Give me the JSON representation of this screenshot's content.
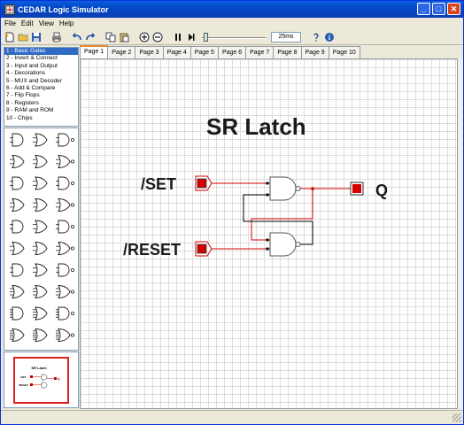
{
  "window": {
    "title": "CEDAR Logic Simulator"
  },
  "menu": [
    "File",
    "Edit",
    "View",
    "Help"
  ],
  "toolbar": {
    "speed": "25ms"
  },
  "tabs": [
    "Page 1",
    "Page 2",
    "Page 3",
    "Page 4",
    "Page 5",
    "Page 6",
    "Page 7",
    "Page 8",
    "Page 9",
    "Page 10"
  ],
  "library": [
    "1 - Basic Gates",
    "2 - Invert & Connect",
    "3 - Input and Output",
    "4 - Decorations",
    "5 - MUX and Decoder",
    "6 - Add & Compare",
    "7 - Flip Flops",
    "8 - Registers",
    "9 - RAM and ROM",
    "10 - Chips"
  ],
  "circuit": {
    "title": "SR  Latch",
    "set_label": "/SET",
    "reset_label": "/RESET",
    "output_label": "Q",
    "colors": {
      "active": "#d40000",
      "wire_low": "#000000",
      "gate": "#555555"
    }
  },
  "preview": {
    "title": "SR  Latch",
    "set_label": "/SET",
    "reset_label": "/RESET",
    "output_label": "Q"
  }
}
